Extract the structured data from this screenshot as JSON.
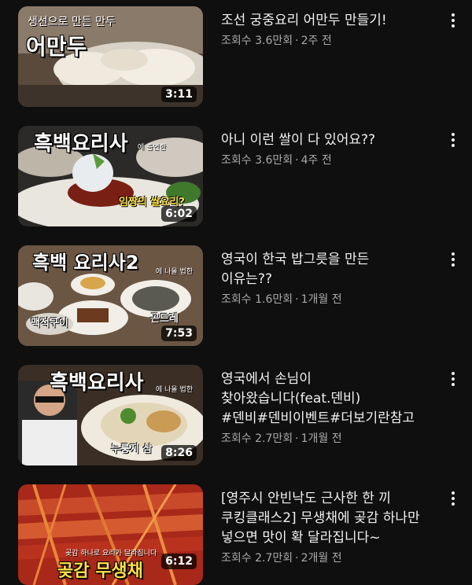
{
  "videos": [
    {
      "title": "조선 궁중요리 어만두 만들기!",
      "views": "조회수 3.6만회",
      "age": "2주 전",
      "duration": "3:11",
      "thumb_text": {
        "main": "어만두",
        "sub": "생선으로 만든 만두"
      }
    },
    {
      "title": "아니 이런 쌀이 다 있어요??",
      "views": "조회수 3.6만회",
      "age": "4주 전",
      "duration": "6:02",
      "thumb_text": {
        "main": "흑백요리사",
        "sub": "에 출연한",
        "caption": "임짱의 쌀요리?"
      }
    },
    {
      "title": "영국이 한국 밥그릇을 만든\n이유는??",
      "views": "조회수 1.6만회",
      "age": "1개월 전",
      "duration": "7:53",
      "thumb_text": {
        "main": "흑백 요리사2",
        "sub": "에 나올 법한",
        "caption": "맥적구이",
        "caption2": "곤드레"
      }
    },
    {
      "title": "영국에서 손님이\n찾아왔습니다(feat.덴비)\n#덴비#덴비이벤트#더보기란참고",
      "views": "조회수 2.7만회",
      "age": "1개월 전",
      "duration": "8:26",
      "thumb_text": {
        "main": "흑백요리사",
        "sub": "에 나올 법한",
        "caption": "누룽지 삼"
      }
    },
    {
      "title": "[영주시 안빈낙도 근사한 한 끼\n쿠킹클래스2] 무생채에 곶감 하나만\n넣으면 맛이 확 달라집니다~",
      "views": "조회수 2.7만회",
      "age": "2개월 전",
      "duration": "6:12",
      "thumb_text": {
        "main": "곶감 무생채",
        "sub": "곶감 하나로 요리가 달라집니다"
      }
    }
  ],
  "meta_separator": "·",
  "icons": {
    "menu": "more-vert-icon"
  },
  "colors": {
    "background": "#0f0f0f",
    "title": "#f1f1f1",
    "meta": "#aaaaaa"
  }
}
